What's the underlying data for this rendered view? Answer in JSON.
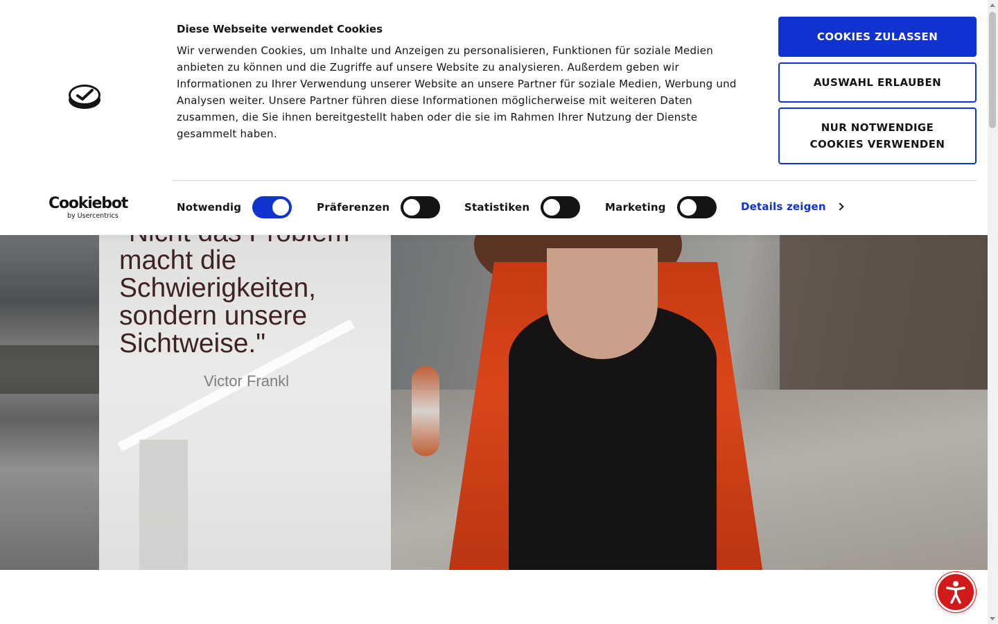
{
  "cookie_banner": {
    "title": "Diese Webseite verwendet Cookies",
    "text": "Wir verwenden Cookies, um Inhalte und Anzeigen zu personalisieren, Funktionen für soziale Medien anbieten zu können und die Zugriffe auf unsere Website zu analysieren. Außerdem geben wir Informationen zu Ihrer Verwendung unserer Website an unsere Partner für soziale Medien, Werbung und Analysen weiter. Unsere Partner führen diese Informationen möglicherweise mit weiteren Daten zusammen, die Sie ihnen bereitgestellt haben oder die sie im Rahmen Ihrer Nutzung der Dienste gesammelt haben.",
    "buttons": {
      "allow_all": "COOKIES ZULASSEN",
      "allow_selection": "AUSWAHL ERLAUBEN",
      "necessary_only": "NUR NOTWENDIGE COOKIES VERWENDEN"
    },
    "toggles": [
      {
        "label": "Notwendig",
        "state": "on"
      },
      {
        "label": "Präferenzen",
        "state": "off"
      },
      {
        "label": "Statistiken",
        "state": "off"
      },
      {
        "label": "Marketing",
        "state": "off"
      }
    ],
    "details_link": "Details zeigen",
    "brand": {
      "name": "Cookiebot",
      "sub": "by Usercentrics"
    },
    "colors": {
      "accent": "#1032cf",
      "text": "#141414",
      "toggle_off": "#141414"
    },
    "icons": {
      "site_logo": "check-badge-icon",
      "details": "chevron-right-icon"
    }
  },
  "hero": {
    "quote": "\"Nicht das Problem macht die Schwierigkeiten, sondern unsere Sichtweise.\"",
    "author": "Victor Frankl",
    "colors": {
      "quote": "#3d2328",
      "author": "#7c7f82"
    }
  },
  "accessibility": {
    "icon": "accessibility-person-icon",
    "color": "#d11a1a"
  }
}
